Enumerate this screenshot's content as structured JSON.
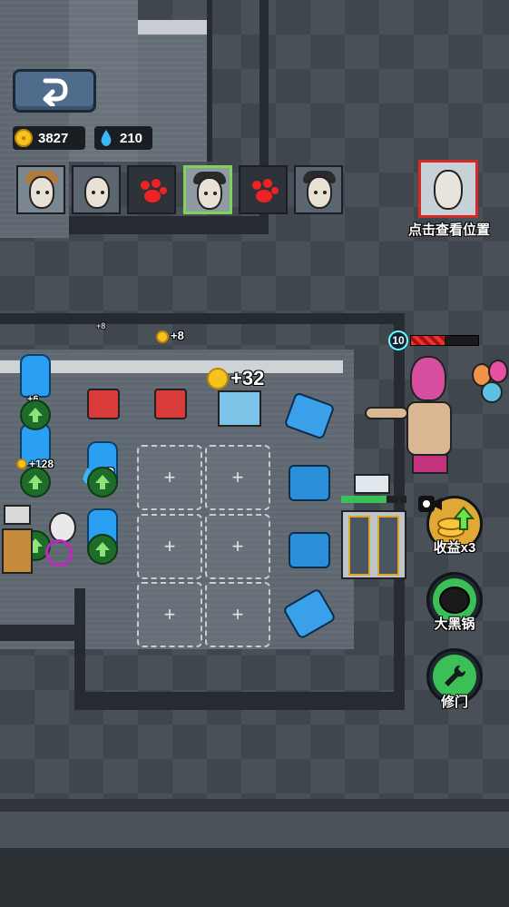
{
  "hud": {
    "back_icon": "return-arrow-icon",
    "gold": "3827",
    "water": "210"
  },
  "characters": [
    {
      "name": "girl-portrait",
      "selected": false,
      "covered": false
    },
    {
      "name": "old-man-portrait",
      "selected": false,
      "covered": false
    },
    {
      "name": "covered-portrait",
      "selected": false,
      "covered": true
    },
    {
      "name": "boy-portrait",
      "selected": true,
      "covered": false
    },
    {
      "name": "covered-portrait",
      "selected": false,
      "covered": true
    },
    {
      "name": "man-portrait",
      "selected": false,
      "covered": false
    }
  ],
  "boss": {
    "locate_label": "点击查看位置",
    "level": "10",
    "hp_fraction": 0.5
  },
  "floating": {
    "coin_small": "+8",
    "coin_room": "+8",
    "coin_big": "+32",
    "coin_128": "+128",
    "water_plus": "+6",
    "water_big": "+2"
  },
  "side_buttons": {
    "income_label": "收益x3",
    "pot_label": "大黑锅",
    "repair_label": "修门"
  },
  "grid_plus": "+",
  "colors": {
    "accent_green": "#3bbf56",
    "gold": "#f5c31b",
    "water_blue": "#2b9ff2",
    "boss_red": "#d62a2a"
  }
}
